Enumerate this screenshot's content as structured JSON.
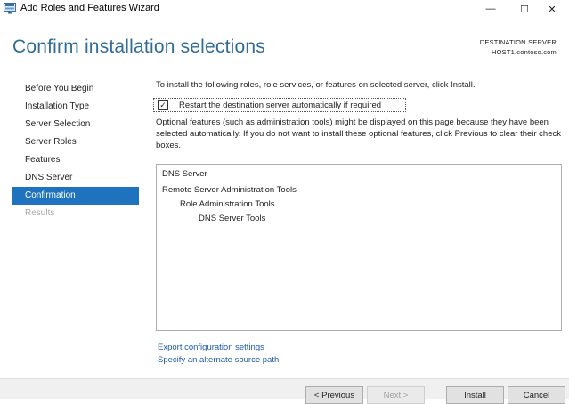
{
  "window": {
    "title": "Add Roles and Features Wizard",
    "controls": {
      "minimize": "—",
      "maximize": "☐",
      "close": "✕"
    }
  },
  "page": {
    "title": "Confirm installation selections",
    "destination_label": "DESTINATION SERVER",
    "destination_server": "HOST1.contoso.com"
  },
  "nav": {
    "items": [
      {
        "label": "Before You Begin",
        "state": "normal"
      },
      {
        "label": "Installation Type",
        "state": "normal"
      },
      {
        "label": "Server Selection",
        "state": "normal"
      },
      {
        "label": "Server Roles",
        "state": "normal"
      },
      {
        "label": "Features",
        "state": "normal"
      },
      {
        "label": "DNS Server",
        "state": "normal"
      },
      {
        "label": "Confirmation",
        "state": "active"
      },
      {
        "label": "Results",
        "state": "disabled"
      }
    ]
  },
  "content": {
    "intro": "To install the following roles, role services, or features on selected server, click Install.",
    "restart_checkbox": {
      "label": "Restart the destination server automatically if required",
      "checked": true,
      "mark": "✓"
    },
    "optional_note": "Optional features (such as administration tools) might be displayed on this page because they have been selected automatically. If you do not want to install these optional features, click Previous to clear their check boxes.",
    "selections": [
      {
        "text": "DNS Server",
        "level": 0
      },
      {
        "text": "Remote Server Administration Tools",
        "level": 0
      },
      {
        "text": "Role Administration Tools",
        "level": 1
      },
      {
        "text": "DNS Server Tools",
        "level": 2
      }
    ],
    "links": {
      "export": "Export configuration settings",
      "alternate_source": "Specify an alternate source path"
    }
  },
  "buttons": {
    "previous": "< Previous",
    "next": "Next >",
    "install": "Install",
    "cancel": "Cancel"
  },
  "colors": {
    "title": "#2f6d96",
    "nav_active_bg": "#1e72be",
    "link": "#1e5aa8"
  }
}
